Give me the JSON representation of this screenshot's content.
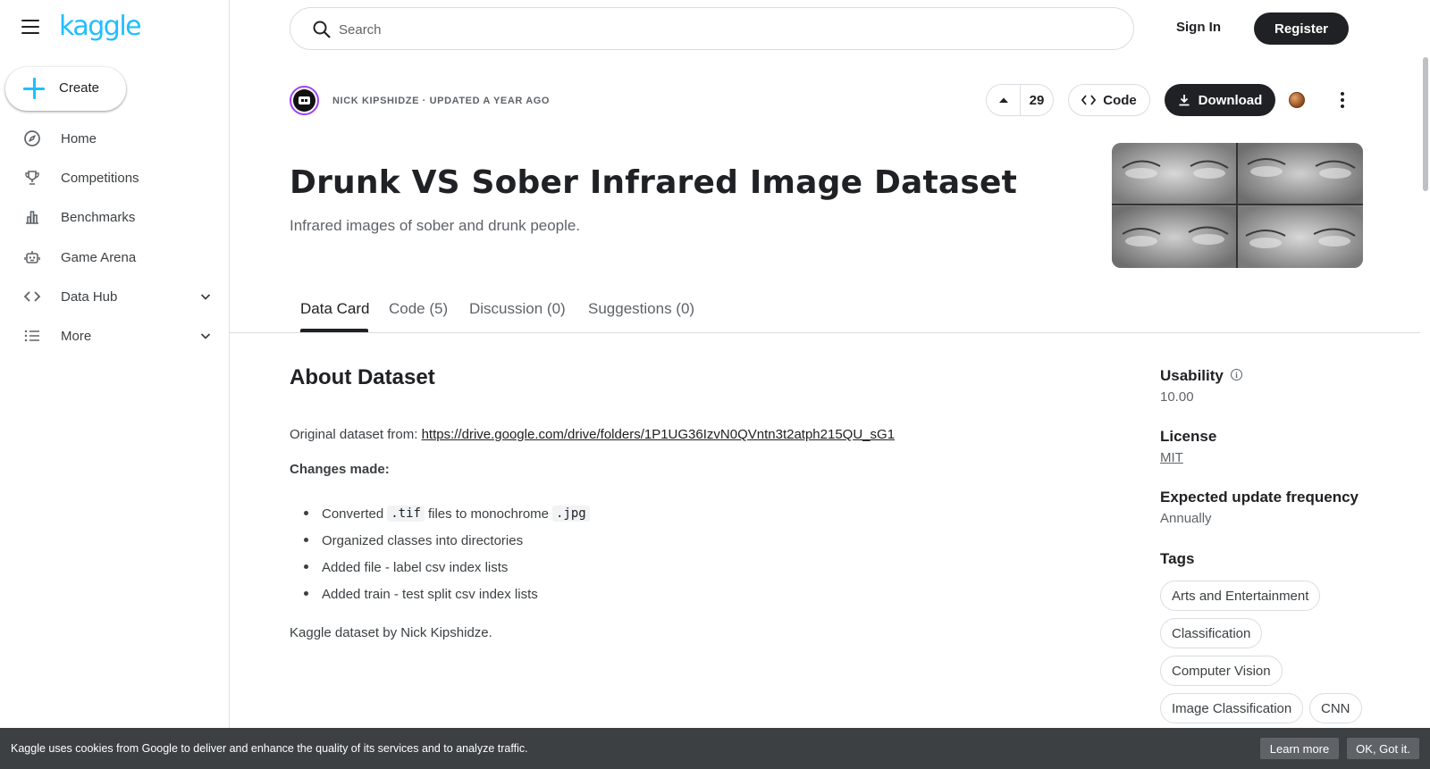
{
  "brand": {
    "logo_text": "kaggle",
    "accent": "#20beff",
    "dark": "#202124"
  },
  "sidebar": {
    "create_label": "Create",
    "items": [
      {
        "label": "Home",
        "icon": "compass-icon"
      },
      {
        "label": "Competitions",
        "icon": "trophy-icon"
      },
      {
        "label": "Benchmarks",
        "icon": "bar-chart-icon"
      },
      {
        "label": "Game Arena",
        "icon": "robot-icon"
      },
      {
        "label": "Data Hub",
        "icon": "code-brackets-icon",
        "expandable": true
      },
      {
        "label": "More",
        "icon": "list-icon",
        "expandable": true
      }
    ]
  },
  "header": {
    "search_placeholder": "Search",
    "sign_in": "Sign In",
    "register": "Register"
  },
  "dataset": {
    "owner_line": "NICK KIPSHIDZE · UPDATED A YEAR AGO",
    "upvotes": "29",
    "code_label": "Code",
    "download_label": "Download",
    "title": "Drunk VS Sober Infrared Image Dataset",
    "subtitle": "Infrared images of sober and drunk people."
  },
  "tabs": [
    {
      "label": "Data Card",
      "active": true
    },
    {
      "label": "Code (5)",
      "active": false
    },
    {
      "label": "Discussion (0)",
      "active": false
    },
    {
      "label": "Suggestions (0)",
      "active": false
    }
  ],
  "about": {
    "heading": "About Dataset",
    "original_prefix": "Original dataset from:",
    "original_link": "https://drive.google.com/drive/folders/1P1UG36IzvN0QVntn3t2atph215QU_sG1",
    "changes_heading": "Changes made:",
    "bullet1_a": "Converted",
    "bullet1_code1": ".tif",
    "bullet1_b": "files to monochrome",
    "bullet1_code2": ".jpg",
    "bullet2": "Organized classes into directories",
    "bullet3": "Added file - label csv index lists",
    "bullet4": "Added train - test split csv index lists",
    "footer": "Kaggle dataset by Nick Kipshidze."
  },
  "meta": {
    "usability_label": "Usability",
    "usability_value": "10.00",
    "license_label": "License",
    "license_value": "MIT",
    "frequency_label": "Expected update frequency",
    "frequency_value": "Annually",
    "tags_label": "Tags",
    "tags": [
      "Arts and Entertainment",
      "Classification",
      "Computer Vision",
      "Image Classification",
      "CNN"
    ]
  },
  "cookie": {
    "message": "Kaggle uses cookies from Google to deliver and enhance the quality of its services and to analyze traffic.",
    "learn_more": "Learn more",
    "ok": "OK, Got it."
  }
}
